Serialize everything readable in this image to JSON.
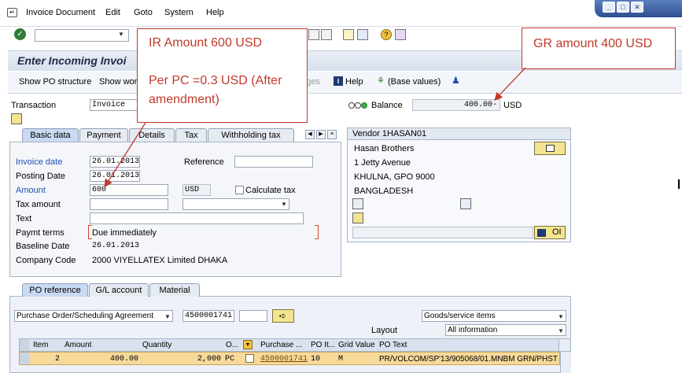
{
  "menu": {
    "items": [
      {
        "label": "Invoice Document",
        "u": "I"
      },
      {
        "label": "Edit",
        "u": "E"
      },
      {
        "label": "Goto",
        "u": "G"
      },
      {
        "label": "System",
        "u": "S"
      },
      {
        "label": "Help",
        "u": "H"
      }
    ]
  },
  "window_controls": {
    "min": "_",
    "max": "□",
    "close": "✕"
  },
  "title": "Enter Incoming Invoi",
  "app_toolbar": {
    "show_po_structure": "Show PO structure",
    "show_wor": "Show wor",
    "ages": "ages",
    "help": "Help",
    "base_values": "(Base values)"
  },
  "header": {
    "transaction_label": "Transaction",
    "transaction_value": "Invoice",
    "balance_label": "Balance",
    "balance_value": "400.00-",
    "balance_currency": "USD"
  },
  "tabs": [
    {
      "label": "Basic data",
      "active": true
    },
    {
      "label": "Payment",
      "active": false
    },
    {
      "label": "Details",
      "active": false
    },
    {
      "label": "Tax",
      "active": false
    },
    {
      "label": "Withholding tax",
      "active": false
    }
  ],
  "basic": {
    "invoice_date_label": "Invoice date",
    "invoice_date_value": "26.01.2013",
    "reference_label": "Reference",
    "reference_value": "",
    "posting_date_label": "Posting Date",
    "posting_date_value": "26.01.2013",
    "amount_label": "Amount",
    "amount_value": "600",
    "amount_currency": "USD",
    "calculate_tax_label": "Calculate tax",
    "tax_amount_label": "Tax amount",
    "tax_amount_value": "",
    "text_label": "Text",
    "text_value": "",
    "paymt_terms_label": "Paymt terms",
    "paymt_terms_value": "Due immediately",
    "baseline_date_label": "Baseline Date",
    "baseline_date_value": "26.01.2013",
    "company_code_label": "Company Code",
    "company_code_value": "2000 VIYELLATEX Limited DHAKA"
  },
  "vendor": {
    "header": "Vendor 1HASAN01",
    "name": "Hasan Brothers",
    "street": "1 Jetty Avenue",
    "city": "KHULNA, GPO 9000",
    "country": "BANGLADESH",
    "oi_label": "OI"
  },
  "lower_tabs": [
    {
      "label": "PO reference",
      "active": true
    },
    {
      "label": "G/L account",
      "active": false
    },
    {
      "label": "Material",
      "active": false
    }
  ],
  "po": {
    "ref_type": "Purchase Order/Scheduling Agreement",
    "po_number": "4500001741",
    "item_type": "Goods/service items",
    "layout_label": "Layout",
    "layout_value": "All information"
  },
  "grid": {
    "columns": [
      "Item",
      "Amount",
      "Quantity",
      "O...",
      "Purchase ...",
      "PO It...",
      "Grid Value",
      "PO Text"
    ],
    "rows": [
      {
        "item": "2",
        "amount": "400.00",
        "quantity": "2,000",
        "unit": "PC",
        "po": "4500001741",
        "po_item": "10",
        "grid": "M",
        "text": "PR/VOLCOM/SP'13/905068/01.MNBM GRN/PHST"
      }
    ]
  },
  "callouts": {
    "ir_line1": "IR Amount 600 USD",
    "ir_line2": "Per PC =0.3 USD (After",
    "ir_line3": "amendment)",
    "gr": "GR amount 400 USD"
  },
  "colors": {
    "callout": "#c0392b",
    "accent": "#1f4fb4",
    "grid_row": "#f7d99a"
  }
}
